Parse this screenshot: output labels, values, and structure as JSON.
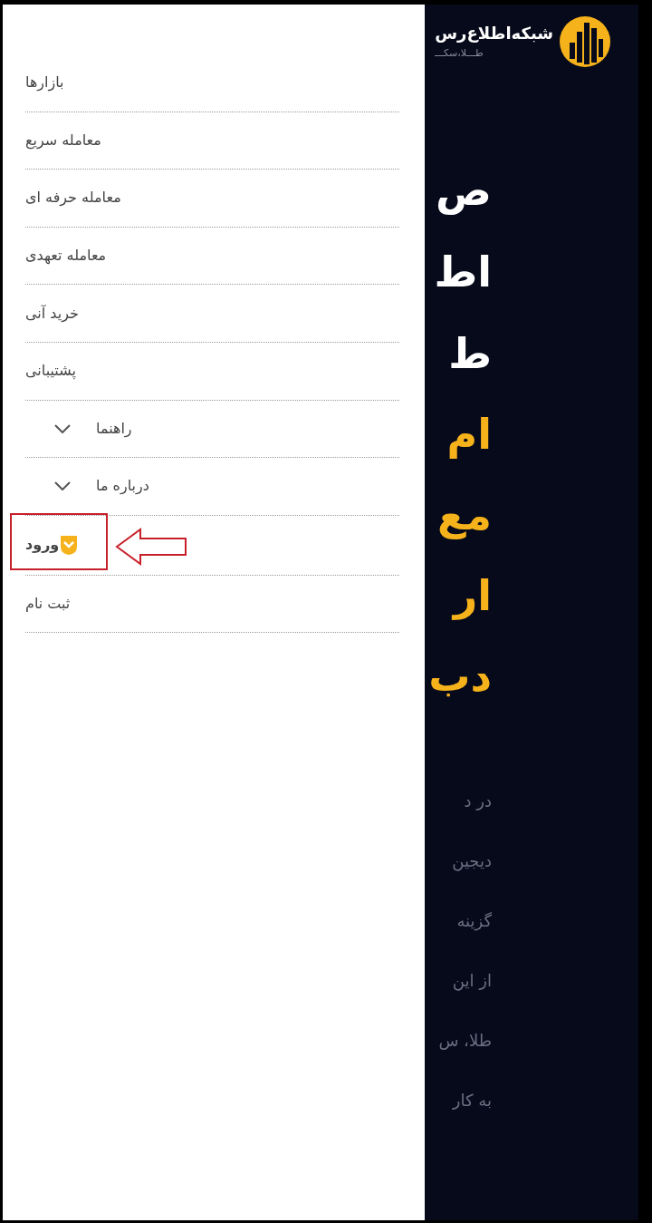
{
  "logo": {
    "title": "شبکه‌اطلاع‌رس",
    "subtitle": "طـــلا،سکـــ"
  },
  "hero": {
    "headline": [
      "ص",
      "اط",
      "ط"
    ],
    "highlight": [
      "ام",
      "مع",
      "ار",
      "دب"
    ],
    "paragraph": [
      "در د",
      "دیجین",
      "گزینه",
      "از این",
      "طلا، س",
      "به کار"
    ]
  },
  "menu": [
    {
      "label": "بازارها",
      "kind": "link"
    },
    {
      "label": "معامله سریع",
      "kind": "link"
    },
    {
      "label": "معامله حرفه ای",
      "kind": "link"
    },
    {
      "label": "معامله تعهدی",
      "kind": "link"
    },
    {
      "label": "خرید آنی",
      "kind": "link"
    },
    {
      "label": "پشتیبانی",
      "kind": "link"
    },
    {
      "label": "راهنما",
      "kind": "dropdown",
      "expanded": false
    },
    {
      "label": "درباره ما",
      "kind": "dropdown",
      "expanded": false
    },
    {
      "label": "ورود",
      "kind": "login",
      "highlighted": true
    },
    {
      "label": "ثبت نام",
      "kind": "link"
    }
  ]
}
